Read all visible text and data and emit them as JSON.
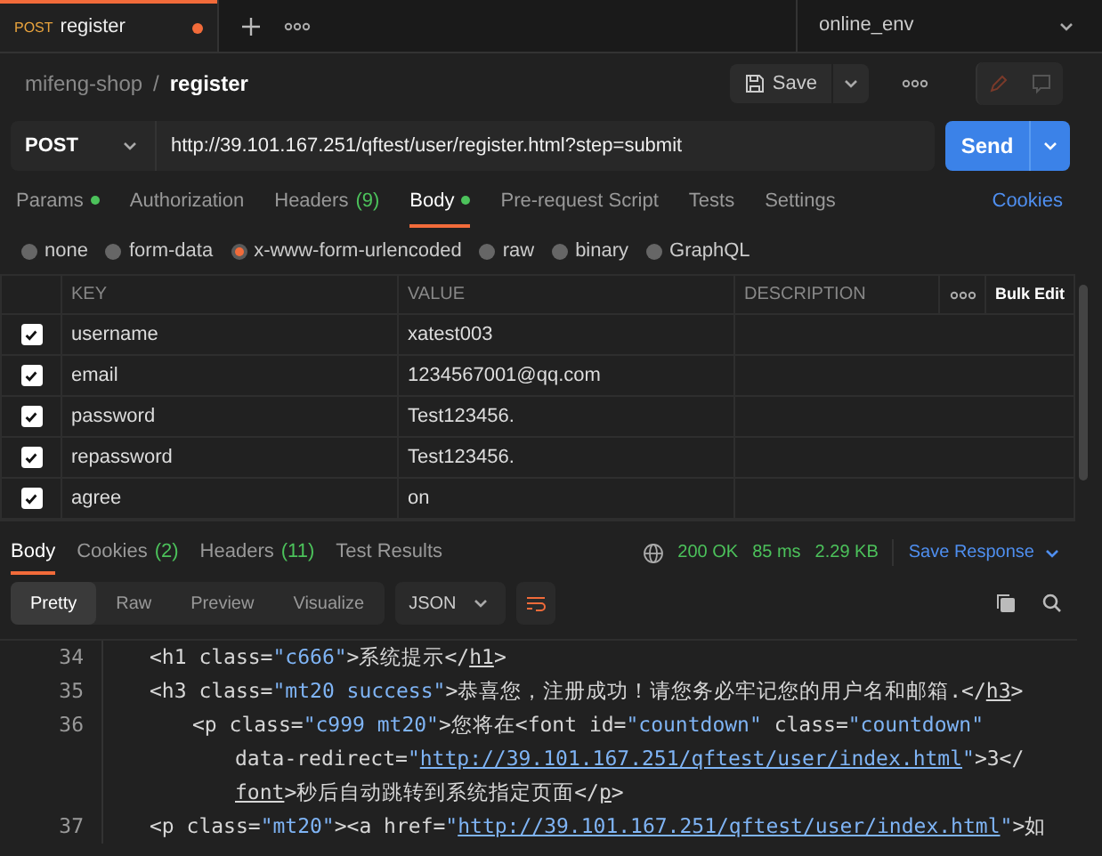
{
  "tabs": [
    {
      "method": "POST",
      "title": "register",
      "unsaved": true,
      "selected": true
    }
  ],
  "environment": "online_env",
  "breadcrumb": {
    "collection": "mifeng-shop",
    "separator": "/",
    "request": "register"
  },
  "save": "Save",
  "request": {
    "method": "POST",
    "url": "http://39.101.167.251/qftest/user/register.html?step=submit",
    "send": "Send"
  },
  "request_tabs": [
    {
      "label": "Params",
      "dot": true,
      "selected": false
    },
    {
      "label": "Authorization",
      "dot": false,
      "selected": false
    },
    {
      "label": "Headers",
      "count": "(9)",
      "dot": false,
      "selected": false
    },
    {
      "label": "Body",
      "dot": true,
      "selected": true
    },
    {
      "label": "Pre-request Script",
      "dot": false,
      "selected": false
    },
    {
      "label": "Tests",
      "dot": false,
      "selected": false
    },
    {
      "label": "Settings",
      "dot": false,
      "selected": false
    }
  ],
  "cookies": "Cookies",
  "body_types": [
    {
      "label": "none",
      "selected": false
    },
    {
      "label": "form-data",
      "selected": false
    },
    {
      "label": "x-www-form-urlencoded",
      "selected": true
    },
    {
      "label": "raw",
      "selected": false
    },
    {
      "label": "binary",
      "selected": false
    },
    {
      "label": "GraphQL",
      "selected": false
    }
  ],
  "table": {
    "columns": [
      "KEY",
      "VALUE",
      "DESCRIPTION"
    ],
    "bulk_edit": "Bulk Edit",
    "rows": [
      {
        "checked": true,
        "key": "username",
        "value": "xatest003"
      },
      {
        "checked": true,
        "key": "email",
        "value": "1234567001@qq.com"
      },
      {
        "checked": true,
        "key": "password",
        "value": "Test123456."
      },
      {
        "checked": true,
        "key": "repassword",
        "value": "Test123456."
      },
      {
        "checked": true,
        "key": "agree",
        "value": "on"
      }
    ]
  },
  "response_tabs": [
    {
      "label": "Body",
      "selected": true
    },
    {
      "label": "Cookies",
      "count": "(2)",
      "selected": false
    },
    {
      "label": "Headers",
      "count": "(11)",
      "selected": false
    },
    {
      "label": "Test Results",
      "selected": false
    }
  ],
  "status": {
    "code": "200 OK",
    "time": "85 ms",
    "size": "2.29 KB"
  },
  "save_response": "Save Response",
  "view_modes": [
    {
      "label": "Pretty",
      "selected": true
    },
    {
      "label": "Raw",
      "selected": false
    },
    {
      "label": "Preview",
      "selected": false
    },
    {
      "label": "Visualize",
      "selected": false
    }
  ],
  "format": "JSON",
  "code": [
    {
      "number": "34",
      "nested": false,
      "wrapped_lines": [
        {
          "segments": [
            {
              "kind": "plain",
              "text": "<h1 class="
            },
            {
              "kind": "str",
              "text": "\"c666\""
            },
            {
              "kind": "plain",
              "text": ">系统提示</"
            },
            {
              "kind": "under",
              "text": "h1"
            },
            {
              "kind": "plain",
              "text": ">"
            }
          ]
        }
      ]
    },
    {
      "number": "35",
      "nested": false,
      "wrapped_lines": [
        {
          "segments": [
            {
              "kind": "plain",
              "text": "<h3 class="
            },
            {
              "kind": "str",
              "text": "\"mt20 success\""
            },
            {
              "kind": "plain",
              "text": ">恭喜您，注册成功！请您务必牢记您的用户名和邮箱.</"
            },
            {
              "kind": "under",
              "text": "h3"
            },
            {
              "kind": "plain",
              "text": ">"
            }
          ]
        }
      ]
    },
    {
      "number": "36",
      "nested": true,
      "wrapped_lines": [
        {
          "segments": [
            {
              "kind": "plain",
              "text": "<p class="
            },
            {
              "kind": "str",
              "text": "\"c999 mt20\""
            },
            {
              "kind": "plain",
              "text": ">您将在<font id="
            },
            {
              "kind": "str",
              "text": "\"countdown\""
            },
            {
              "kind": "plain",
              "text": " class="
            },
            {
              "kind": "str",
              "text": "\"countdown\""
            }
          ]
        },
        {
          "segments": [
            {
              "kind": "plain",
              "text": "data-redirect="
            },
            {
              "kind": "str",
              "text": "\""
            },
            {
              "kind": "link",
              "text": "http://39.101.167.251/qftest/user/index.html"
            },
            {
              "kind": "str",
              "text": "\""
            },
            {
              "kind": "plain",
              "text": ">3</"
            }
          ]
        },
        {
          "segments": [
            {
              "kind": "under",
              "text": "font"
            },
            {
              "kind": "plain",
              "text": ">秒后自动跳转到系统指定页面</"
            },
            {
              "kind": "under",
              "text": "p"
            },
            {
              "kind": "plain",
              "text": ">"
            }
          ]
        }
      ]
    },
    {
      "number": "37",
      "nested": false,
      "wrapped_lines": [
        {
          "segments": [
            {
              "kind": "plain",
              "text": "<p class="
            },
            {
              "kind": "str",
              "text": "\"mt20\""
            },
            {
              "kind": "plain",
              "text": "><a href="
            },
            {
              "kind": "str",
              "text": "\""
            },
            {
              "kind": "link",
              "text": "http://39.101.167.251/qftest/user/index.html"
            },
            {
              "kind": "str",
              "text": "\""
            },
            {
              "kind": "plain",
              "text": ">如"
            }
          ]
        }
      ]
    }
  ]
}
